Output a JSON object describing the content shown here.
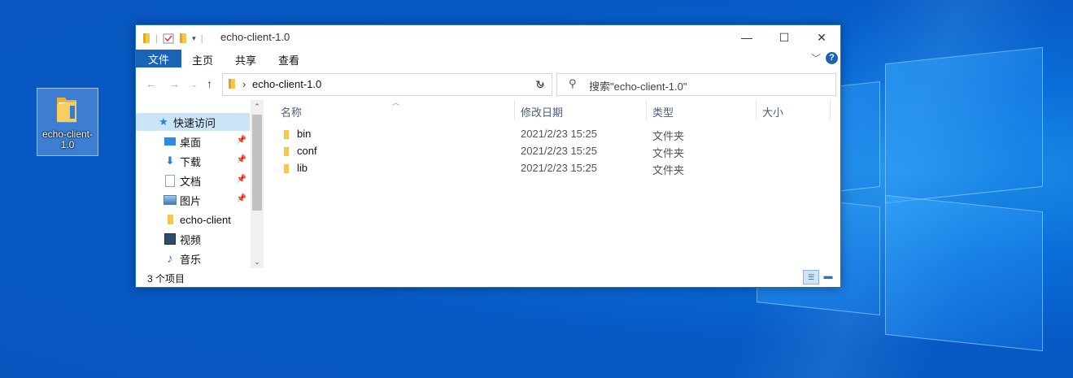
{
  "desktop": {
    "icon_label_line1": "echo-client-",
    "icon_label_line2": "1.0"
  },
  "window": {
    "title": "echo-client-1.0",
    "controls": {
      "minimize": "—",
      "maximize": "☐",
      "close": "✕"
    },
    "ribbon": {
      "file_tab": "文件",
      "tabs": [
        "主页",
        "共享",
        "查看"
      ],
      "help": "?"
    },
    "address": {
      "path": "echo-client-1.0",
      "search_placeholder": "搜索\"echo-client-1.0\""
    },
    "sidebar": {
      "items": [
        {
          "label": "快速访问",
          "icon": "star-icon"
        },
        {
          "label": "桌面",
          "icon": "desktop-icon"
        },
        {
          "label": "下载",
          "icon": "download-icon"
        },
        {
          "label": "文档",
          "icon": "document-icon"
        },
        {
          "label": "图片",
          "icon": "picture-icon"
        },
        {
          "label": "echo-client",
          "icon": "folder-icon"
        },
        {
          "label": "视频",
          "icon": "video-icon"
        },
        {
          "label": "音乐",
          "icon": "music-icon"
        }
      ]
    },
    "columns": [
      "名称",
      "修改日期",
      "类型",
      "大小"
    ],
    "files": [
      {
        "name": "bin",
        "date": "2021/2/23 15:25",
        "type": "文件夹"
      },
      {
        "name": "conf",
        "date": "2021/2/23 15:25",
        "type": "文件夹"
      },
      {
        "name": "lib",
        "date": "2021/2/23 15:25",
        "type": "文件夹"
      }
    ],
    "status": "3 个项目"
  },
  "colors": {
    "accent": "#1a63b8",
    "folder": "#f2c94c",
    "selection": "#cce4f7"
  }
}
